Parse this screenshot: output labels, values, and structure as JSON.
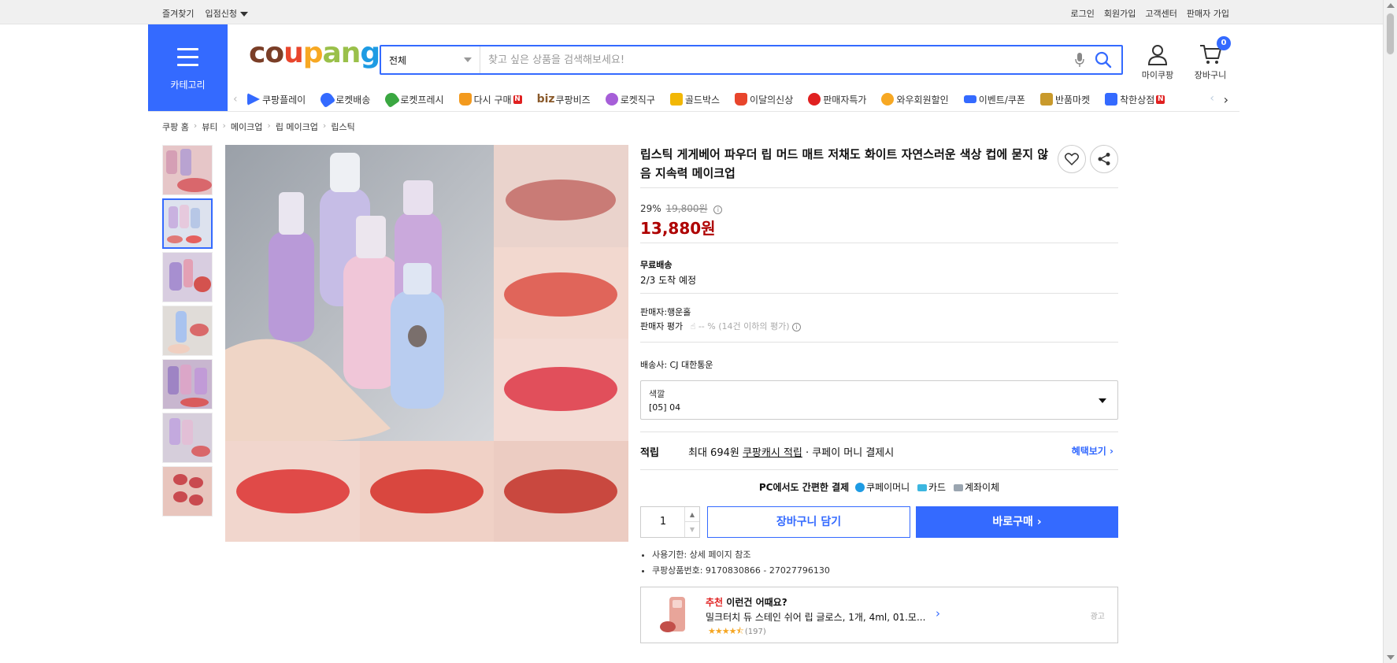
{
  "topbar": {
    "left": [
      "즐겨찾기",
      "입점신청"
    ],
    "right": [
      "로그인",
      "회원가입",
      "고객센터",
      "판매자 가입"
    ]
  },
  "header": {
    "category_label": "카테고리",
    "logo": "coupang",
    "search": {
      "category": "전체",
      "placeholder": "찾고 싶은 상품을 검색해보세요!"
    },
    "mycoupang_label": "마이쿠팡",
    "cart_label": "장바구니",
    "cart_count": "0"
  },
  "quick_menu": [
    {
      "label": "쿠팡플레이",
      "color": "#346aff"
    },
    {
      "label": "로켓배송",
      "color": "#346aff"
    },
    {
      "label": "로켓프레시",
      "color": "#3aa741"
    },
    {
      "label": "다시 구매",
      "color": "#f39a1e",
      "badge": "N"
    },
    {
      "label": "쿠팡비즈",
      "prefix": "biz",
      "color": "#8a5a2b"
    },
    {
      "label": "로켓직구",
      "color": "#a65ed8"
    },
    {
      "label": "골드박스",
      "color": "#f2b705"
    },
    {
      "label": "이달의신상",
      "color": "#e8452c"
    },
    {
      "label": "판매자특가",
      "color": "#e02020"
    },
    {
      "label": "와우회원할인",
      "color": "#f7a823"
    },
    {
      "label": "이벤트/쿠폰",
      "color": "#346aff"
    },
    {
      "label": "반품마켓",
      "color": "#c99a2c"
    },
    {
      "label": "착한상점",
      "color": "#346aff",
      "badge": "N"
    }
  ],
  "breadcrumb": [
    "쿠팡 홈",
    "뷰티",
    "메이크업",
    "립 메이크업",
    "립스틱"
  ],
  "product": {
    "title": "립스틱 게게베어 파우더 립 머드 매트 저채도 화이트 자연스러운 색상 컵에 묻지 않음 지속력 메이크업",
    "discount": "29%",
    "original_price": "19,800원",
    "price": "13,880원",
    "shipping_title": "무료배송",
    "shipping_eta": "2/3 도착 예정",
    "seller": "판매자:행운홀",
    "seller_rating_label": "판매자 평가",
    "seller_rating_value": "-- %",
    "seller_rating_note": "(14건 이하의 평가)",
    "courier": "배송사:  CJ 대한통운",
    "option_label": "색깔",
    "option_value": "[05] 04",
    "reward_title": "적립",
    "reward_prefix": "최대 694원",
    "reward_link": "쿠팡캐시 적립",
    "reward_suffix": "· 쿠페이 머니 결제시",
    "reward_more": "혜택보기",
    "pay_title": "PC에서도 간편한 결제",
    "pay_methods": [
      "쿠페이머니",
      "카드",
      "계좌이체"
    ],
    "quantity": "1",
    "add_cart": "장바구니 담기",
    "buy_now": "바로구매",
    "notes": [
      "사용기한: 상세 페이지 참조",
      "쿠팡상품번호: 9170830866 - 27027796130"
    ]
  },
  "recommendation": {
    "tag": "추천",
    "title": "이런건 어때요?",
    "item": "밀크터치 듀 스테인 쉬어 립 글로스, 1개, 4ml, 01.모...",
    "rating": 4.5,
    "review_count": "(197)",
    "ad_label": "광고"
  }
}
